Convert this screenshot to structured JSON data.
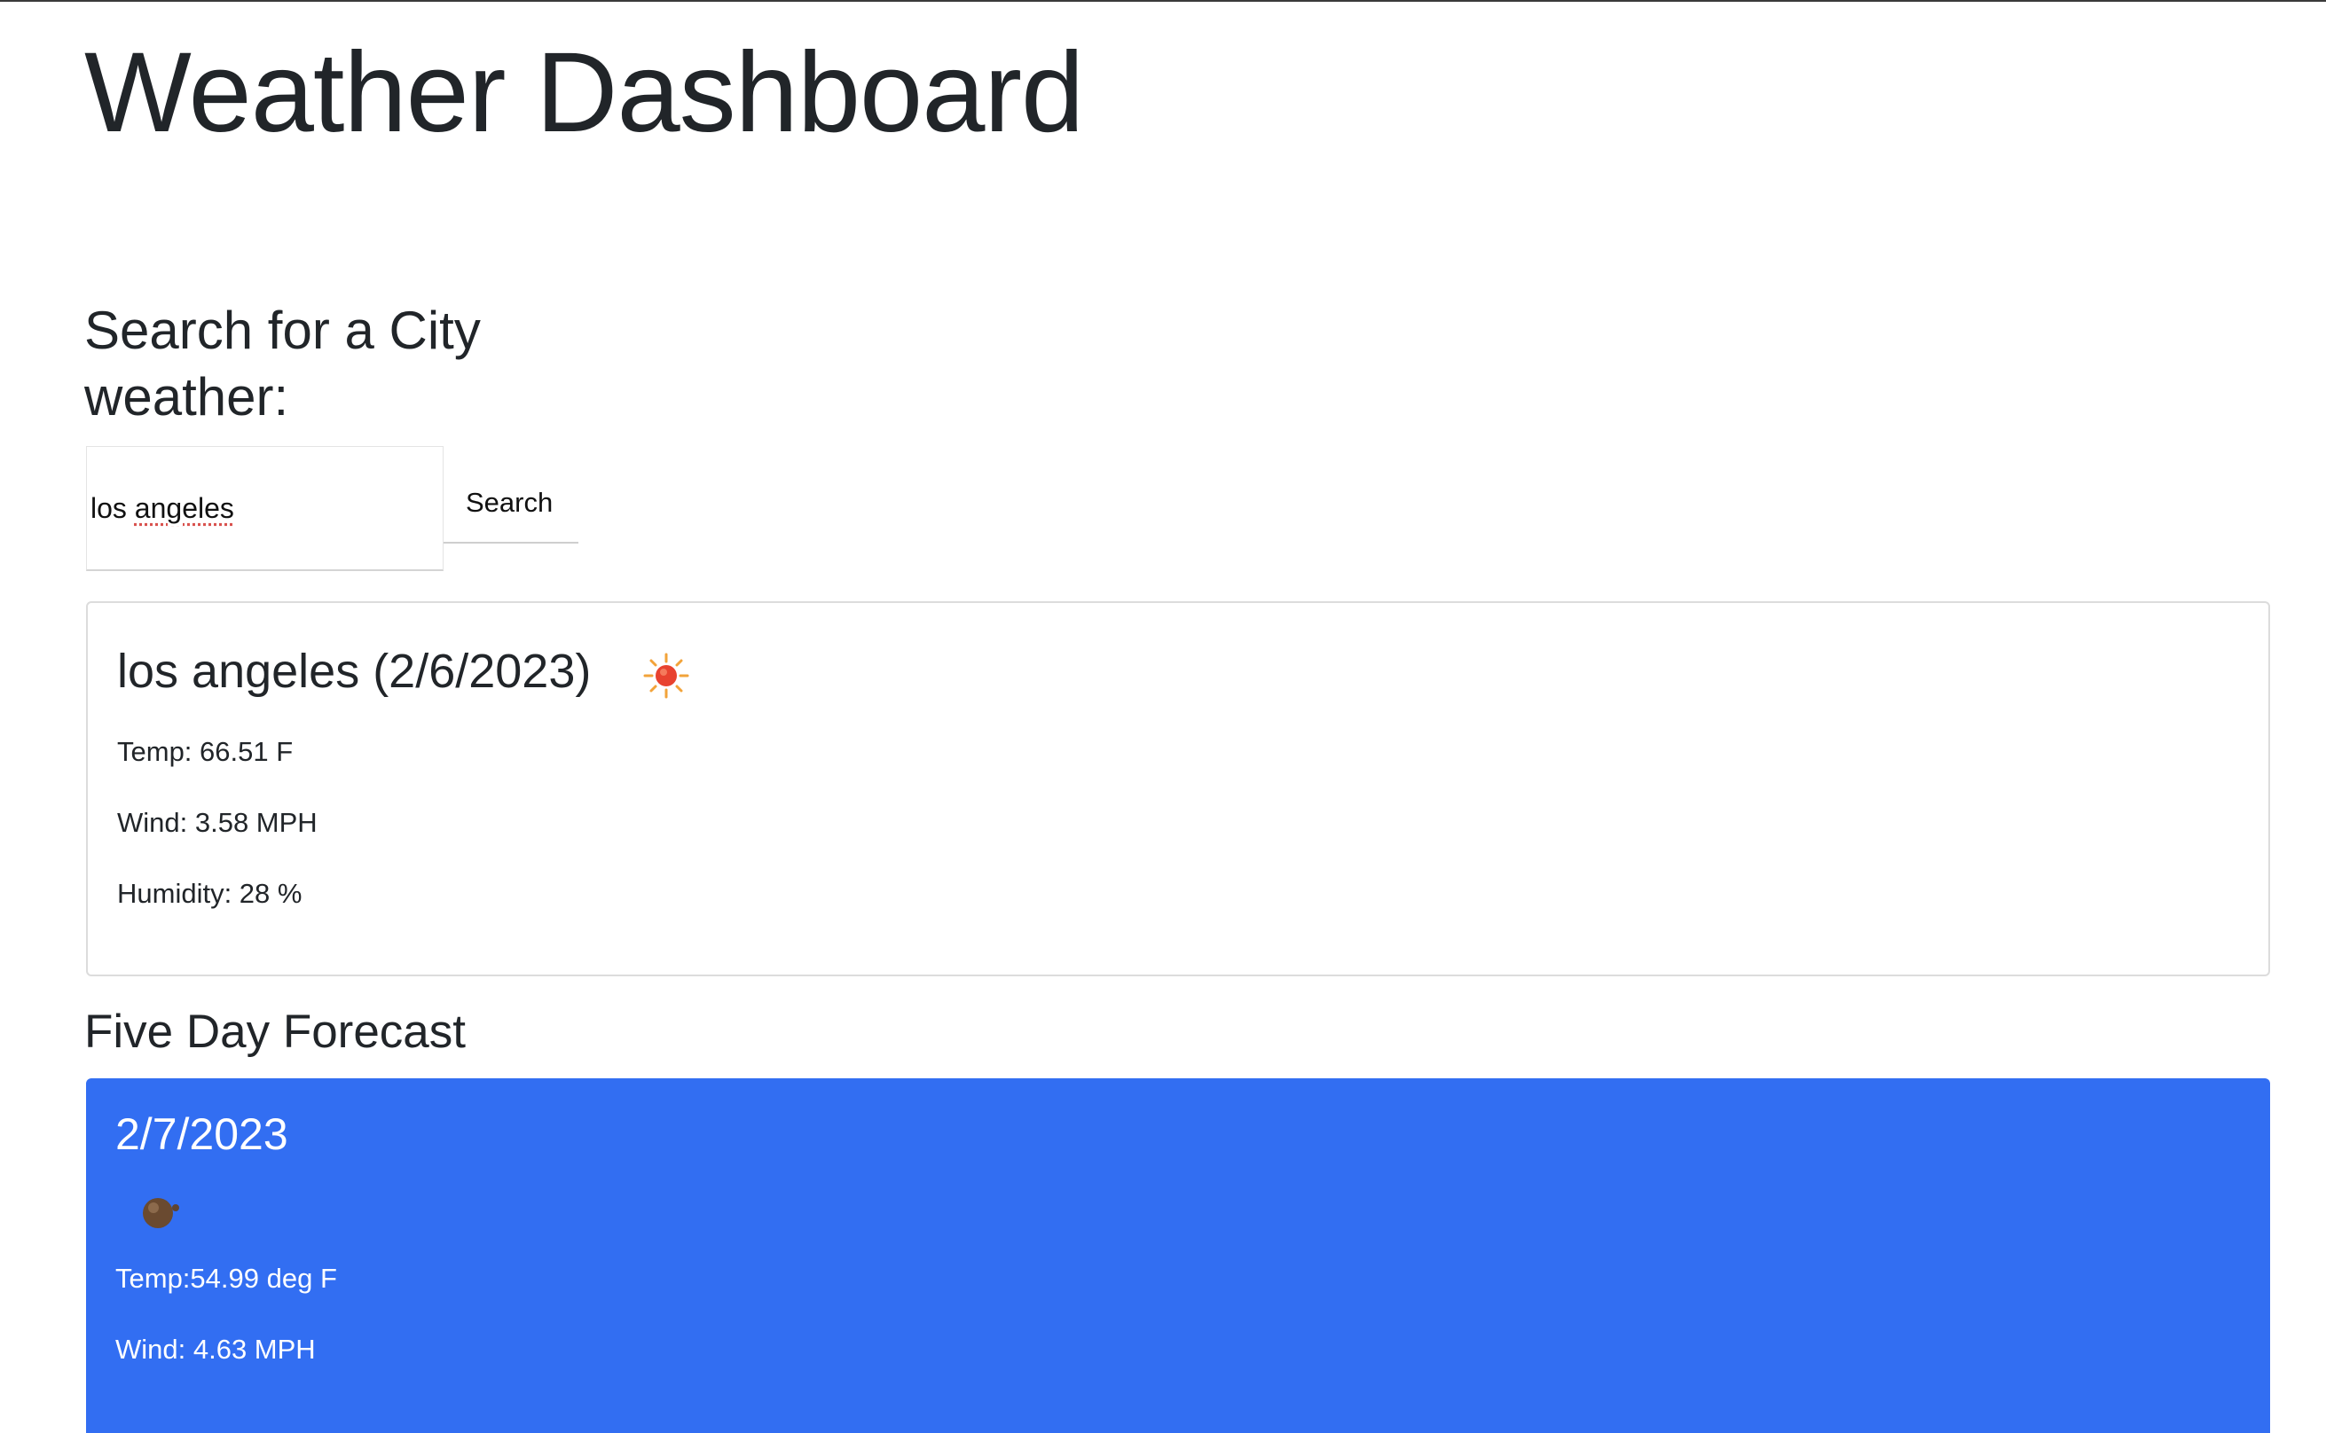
{
  "header": {
    "title": "Weather Dashboard"
  },
  "search": {
    "heading": "Search for a City weather:",
    "input_value": "los angeles",
    "button_label": "Search"
  },
  "current": {
    "title": "los angeles (2/6/2023)",
    "icon": "sun-icon",
    "temp": "Temp: 66.51 F",
    "wind": "Wind: 3.58 MPH",
    "humidity": "Humidity: 28 %"
  },
  "forecast": {
    "heading": "Five Day Forecast",
    "accent_color": "#326ef2",
    "days": [
      {
        "date": "2/7/2023",
        "icon": "cloud-icon",
        "temp": "Temp:54.99 deg F",
        "wind": "Wind: 4.63 MPH"
      }
    ]
  }
}
